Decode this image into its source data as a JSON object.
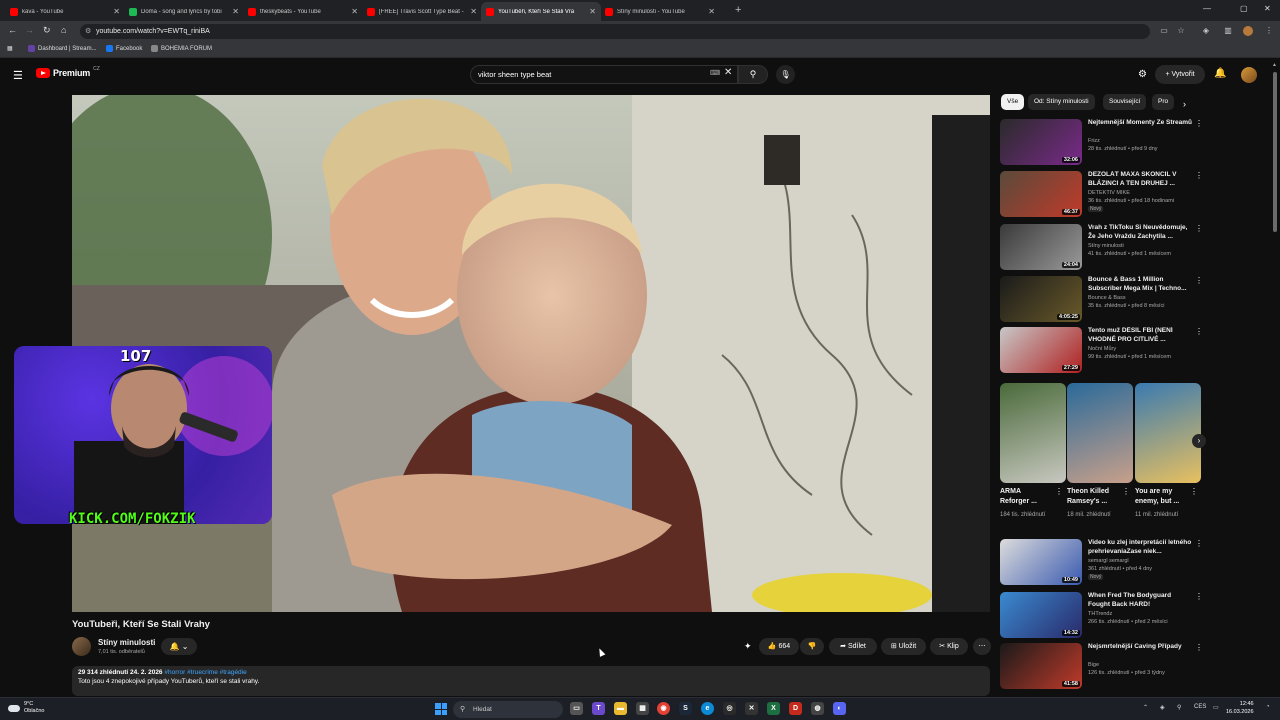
{
  "browser": {
    "tabs": [
      {
        "title": "kava - YouTube",
        "fav": "#ff0000",
        "active": false
      },
      {
        "title": "Doma - song and lyrics by tobi",
        "fav": "#1db954",
        "active": false
      },
      {
        "title": "theskybeats - YouTube",
        "fav": "#ff0000",
        "active": false
      },
      {
        "title": "[FREE] Travis Scott Type Beat -",
        "fav": "#ff0000",
        "active": false
      },
      {
        "title": "YouTuběři, Kteří Se Stali Vra",
        "fav": "#ff0000",
        "active": true
      },
      {
        "title": "Stíny minulosti - YouTube",
        "fav": "#ff0000",
        "active": false
      }
    ],
    "url": "youtube.com/watch?v=EWTq_riniBA",
    "bookmarks": [
      {
        "label": "Dashboard | Stream...",
        "color": "#6441a5"
      },
      {
        "label": "Facebook",
        "color": "#1877f2"
      },
      {
        "label": "BOHEMIA FORUM",
        "color": "#888888"
      }
    ]
  },
  "yt": {
    "logo_text": "Premium",
    "country": "CZ",
    "search_query": "viktor sheen type beat",
    "create_label": "Vytvořit"
  },
  "overlay": {
    "viewer_count": "107",
    "kick": "KICK.COM/FOKZIK"
  },
  "video": {
    "title": "YouTubeři, Kteří Se Stali Vrahy",
    "channel": "Stíny minulosti",
    "subs": "7,01 tis. odběratelů",
    "likes": "664",
    "share_label": "Sdílet",
    "save_label": "Uložit",
    "clip_label": "Klip",
    "views_date": "29 314 zhlédnutí  24. 2. 2026",
    "tags": "#horror #truecrime #tragédie",
    "description": "Toto jsou 4 znepokojivé případy YouTuberů, kteří se stali vrahy."
  },
  "chips": [
    "Vše",
    "Od: Stíny minulosti",
    "Související",
    "Pro"
  ],
  "recommendations": [
    {
      "title": "Nejtemnější Momenty Ze Streamů",
      "channel": "Frizz",
      "meta": "28 tis. zhlédnutí • před 9 dny",
      "duration": "32:06",
      "badge": "",
      "c1": "#2a2a2a",
      "c2": "#7a2a8a"
    },
    {
      "title": "DEZOLÁT MAXA SKONČIL V BLÁZINCI A TEN DRUHEJ ...",
      "channel": "DETEKTIV MIKE",
      "meta": "36 tis. zhlédnutí • před 18 hodinami",
      "duration": "46:37",
      "badge": "Nový",
      "c1": "#5a4a3a",
      "c2": "#c03a2a"
    },
    {
      "title": "Vrah z TikToku Si Neuvědomuje, Že Jeho Vraždu Zachytila ...",
      "channel": "Stíny minulosti",
      "meta": "41 tis. zhlédnutí • před 1 měsícem",
      "duration": "24:04",
      "badge": "",
      "c1": "#3a3a3a",
      "c2": "#9a9a9a"
    },
    {
      "title": "Bounce & Bass 1 Million Subscriber Mega Mix | Techno...",
      "channel": "Bounce & Bass",
      "meta": "35 tis. zhlédnutí • před 8 měsíci",
      "duration": "4:05:25",
      "badge": "",
      "c1": "#1a1a1a",
      "c2": "#6a5a2a"
    },
    {
      "title": "Tento muž DĚSIL FBI (NENÍ VHODNÉ PRO CITLIVÉ ...",
      "channel": "Noční Můry",
      "meta": "99 tis. zhlédnutí • před 1 měsícem",
      "duration": "27:29",
      "badge": "",
      "c1": "#c8c8c8",
      "c2": "#b02020"
    }
  ],
  "shorts": [
    {
      "title": "ARMA Reforger ...",
      "views": "184 tis. zhlédnutí",
      "c1": "#4a6a3a",
      "c2": "#c8c8c0"
    },
    {
      "title": "Theon Killed Ramsey's ...",
      "views": "18 mil. zhlédnutí",
      "c1": "#2a6a9a",
      "c2": "#c8a08a"
    },
    {
      "title": "You are my enemy, but ...",
      "views": "11 mil. zhlédnutí",
      "c1": "#3a7ab0",
      "c2": "#e8c060"
    }
  ],
  "recommendations2": [
    {
      "title": "Video ku zlej interpretácií letného prehrievaniaZase niek...",
      "channel": "semargl semargl",
      "meta": "361 zhlédnutí • před 4 dny",
      "duration": "10:49",
      "badge": "Nový",
      "c1": "#dcdcdc",
      "c2": "#3a5ab0"
    },
    {
      "title": "When Fred The Bodyguard Fought Back HARD!",
      "channel": "THTrendz",
      "meta": "266 tis. zhlédnutí • před 2 měsíci",
      "duration": "14:32",
      "badge": "",
      "c1": "#3a8ad0",
      "c2": "#2a2a6a"
    },
    {
      "title": "Nejsmrtelnější Caving Případy",
      "channel": "Bige",
      "meta": "126 tis. zhlédnutí • před 3 týdny",
      "duration": "41:58",
      "badge": "",
      "c1": "#1a1a1a",
      "c2": "#c03a2a"
    }
  ],
  "taskbar": {
    "weather_temp": "9°C",
    "weather_desc": "Oblačno",
    "search_placeholder": "Hledat",
    "lang": "CES",
    "time": "12:46",
    "date": "16.03.2026"
  }
}
